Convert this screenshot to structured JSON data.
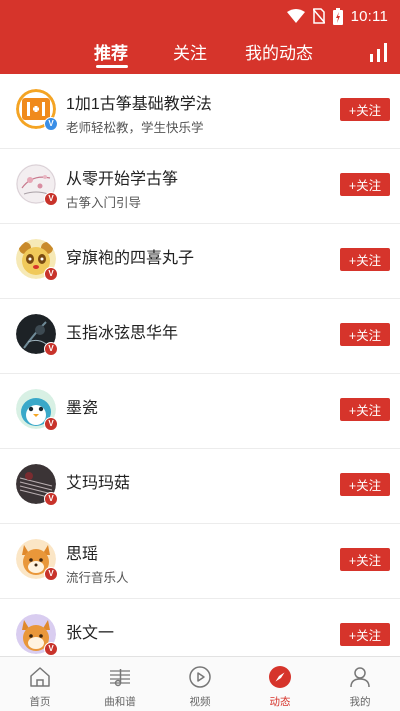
{
  "status_bar": {
    "time": "10:11"
  },
  "tabs": [
    {
      "label": "推荐",
      "active": true
    },
    {
      "label": "关注",
      "active": false
    },
    {
      "label": "我的动态",
      "active": false
    }
  ],
  "header": {
    "stats_icon": "bar-chart-icon"
  },
  "follow_label": "+关注",
  "users": [
    {
      "name": "1加1古筝基础教学法",
      "subtitle": "老师轻松教，学生快乐学",
      "badge": "blue",
      "avatar_icon": "1plus1-logo-avatar"
    },
    {
      "name": "从零开始学古筝",
      "subtitle": "古筝入门引导",
      "badge": "red",
      "avatar_icon": "floral-avatar"
    },
    {
      "name": "穿旗袍的四喜丸子",
      "subtitle": "",
      "badge": "red",
      "avatar_icon": "panda-avatar"
    },
    {
      "name": "玉指冰弦思华年",
      "subtitle": "",
      "badge": "red",
      "avatar_icon": "dark-photo-avatar"
    },
    {
      "name": "墨瓷",
      "subtitle": "",
      "badge": "red",
      "avatar_icon": "penguin-avatar"
    },
    {
      "name": "艾玛玛菇",
      "subtitle": "",
      "badge": "red",
      "avatar_icon": "instrument-photo-avatar"
    },
    {
      "name": "思瑶",
      "subtitle": "流行音乐人",
      "badge": "red",
      "avatar_icon": "fox-avatar"
    },
    {
      "name": "张文一",
      "subtitle": "",
      "badge": "red",
      "avatar_icon": "fox-purple-avatar"
    }
  ],
  "badge_letter": "V",
  "bottom_nav": [
    {
      "label": "首页",
      "icon": "home-icon",
      "active": false
    },
    {
      "label": "曲和谱",
      "icon": "music-score-icon",
      "active": false
    },
    {
      "label": "视频",
      "icon": "video-play-icon",
      "active": false
    },
    {
      "label": "动态",
      "icon": "feed-compass-icon",
      "active": true
    },
    {
      "label": "我的",
      "icon": "profile-icon",
      "active": false
    }
  ],
  "colors": {
    "brand": "#d6342b",
    "badge_blue": "#3a8ee6",
    "badge_red": "#c8332b"
  }
}
